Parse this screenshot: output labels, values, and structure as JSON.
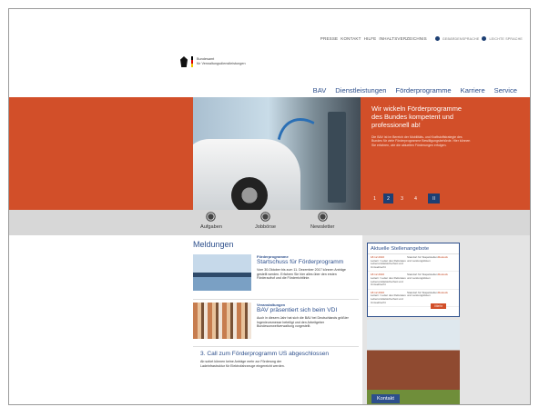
{
  "utility": {
    "links": [
      "PRESSE",
      "KONTAKT",
      "HILFE",
      "INHALTSVERZEICHNIS"
    ],
    "sign_language": "GEBÄRDENSPRACHE",
    "easy_language": "LEICHTE SPRACHE"
  },
  "logo": {
    "line1": "Bundesamt",
    "line2": "für Verwaltungsdienstleistungen"
  },
  "nav": [
    "BAV",
    "Dienstleistungen",
    "Förderprogramme",
    "Karriere",
    "Service"
  ],
  "hero": {
    "title": "Wir wickeln Förderprogramme des Bundes kompetent und professionell ab!",
    "body": "Die BAV ist im Bereich der Mobilitäts- und Kraftstoffstrategie des Bundes für viele Förderprogramme Bewilligungsbehörde. Hier können Sie erfahren, wie die aktuellen Förderungen erfolgen."
  },
  "pager": [
    "1",
    "2",
    "3",
    "4",
    "II"
  ],
  "tiles": [
    "Aufgaben",
    "Jobbörse",
    "Newsletter"
  ],
  "news": {
    "heading": "Meldungen",
    "items": [
      {
        "category": "Förderprogramme",
        "title": "Startschuss für Förderprogramm",
        "body": "Vom 30.Oktober bis zum 11. Dezember 2017 können Anträge gestellt werden. Erfahren Sie hier alles über den ersten Förderaufruf und die Förderrichtlinie."
      },
      {
        "category": "Veranstaltungen",
        "title": "BAV präsentiert sich beim VDI",
        "body": "Auch in diesem Jahr hat sich die BAV bei Deutschlands größter Ingenieursmesse beteiligt und den Arbeitgeber Bundesumweltverwaltung vorgestellt."
      },
      {
        "category": "",
        "title": "3. Call zum Förderprogramm US abgeschlossen",
        "body": "Ab sofort können keine Anträge mehr zur Förderung der Ladeinfrastruktur für Elektrofahrzeuge eingereicht werden."
      }
    ]
  },
  "jobs": {
    "heading": "Aktuelle Stellenangebote",
    "rows": [
      {
        "date": "18.12.2016",
        "title": "Leitern / Leiter des Referates Lebensmittelsicherheit und Umweltrecht",
        "place": "Standort für Stapelstellen und Leistungslisten",
        "loc": "Rostock"
      },
      {
        "date": "18.12.2016",
        "title": "Leitern / Leiter des Referates Lebensmittelsicherheit und Umweltrecht",
        "place": "Standort für Stapelstellen und Leistungslisten",
        "loc": "Rostock"
      },
      {
        "date": "18.12.2016",
        "title": "Leitern / Leiter des Referates Lebensmittelsicherheit und Umweltrecht",
        "place": "Standort für Stapelstellen und Leistungslisten",
        "loc": "Rostock"
      }
    ],
    "more": "Mehr"
  },
  "contact": "Kontakt",
  "colors": {
    "accent": "#d24f29",
    "brand": "#2d4f8c"
  }
}
